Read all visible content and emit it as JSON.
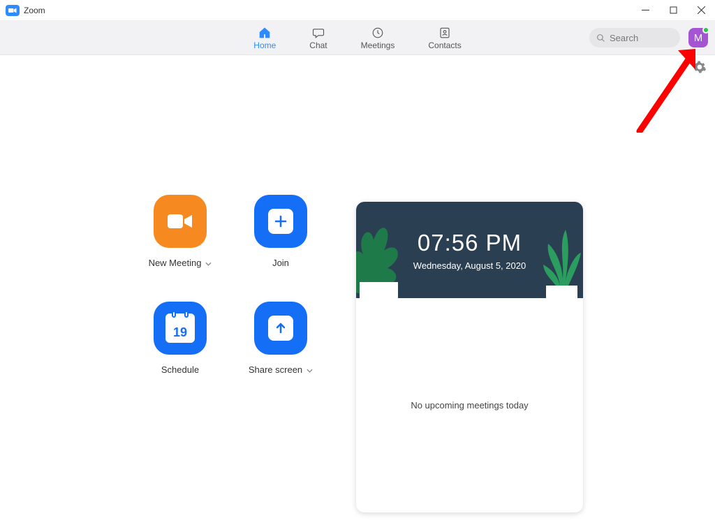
{
  "window": {
    "title": "Zoom"
  },
  "nav": {
    "tabs": {
      "home": "Home",
      "chat": "Chat",
      "meetings": "Meetings",
      "contacts": "Contacts"
    },
    "search_placeholder": "Search",
    "avatar_initial": "M"
  },
  "actions": {
    "new_meeting": "New Meeting",
    "join": "Join",
    "schedule": "Schedule",
    "schedule_day": "19",
    "share_screen": "Share screen"
  },
  "panel": {
    "time": "07:56 PM",
    "date": "Wednesday, August 5, 2020",
    "empty_message": "No upcoming meetings today"
  }
}
